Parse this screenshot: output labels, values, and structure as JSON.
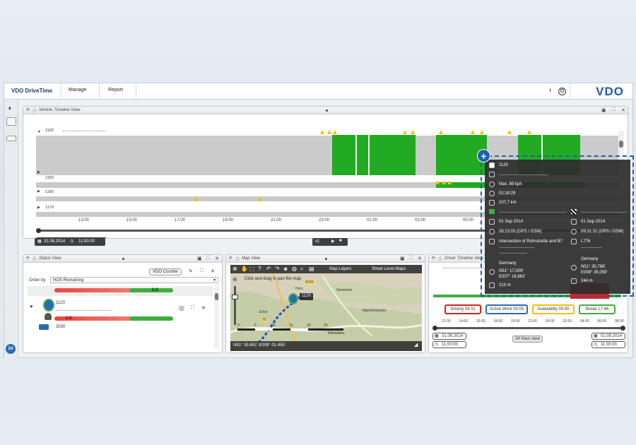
{
  "app": {
    "brand": "VDO DriveTime",
    "nav": [
      "Manage",
      "Report"
    ],
    "logo": "VDO",
    "info_label": "i"
  },
  "vehicle_timeline": {
    "title": "Vehicle Timeline View",
    "vehicles": [
      "1120",
      "1150",
      "1160",
      "1170"
    ],
    "hours": [
      "13:00",
      "15:00",
      "17:00",
      "19:00",
      "21:00",
      "23:00",
      "01:00",
      "03:00",
      "05:00"
    ],
    "date": "31.08.2014",
    "time": "11:00:00",
    "speed": "x1"
  },
  "status": {
    "title": "Status View",
    "counter_button": "VDO Counter",
    "order_by_label": "Order by",
    "order_by_value": "HOS Remaining",
    "row1_value": "8.8",
    "row2_vehicle": "1120",
    "row2_value": "0.9",
    "row3_vehicle": "3030"
  },
  "map": {
    "title": "Map View",
    "layers_label": "Map Layers",
    "maptype_label": "Street Level Maps",
    "hint": "Click and drag to pan the map",
    "marker_label": "1120",
    "scale": [
      "0",
      "5",
      "10",
      "15",
      "20",
      "25"
    ],
    "scale_unit": "Kilometers",
    "coords": "N51° 33.651' E009° 01.455'",
    "places": [
      "Horn",
      "Steinheim",
      "Marienmünster",
      "B1",
      "B239",
      "Schie"
    ]
  },
  "driver": {
    "title": "Driver Timeline View",
    "driving": "Driving 04:31",
    "active_work": "Active Work 00:05",
    "availability": "Availability 00:00",
    "break": "Break 17:46",
    "hours": [
      "12:00",
      "14:00",
      "16:00",
      "18:00",
      "20:00",
      "22:00",
      "00:00",
      "02:00",
      "04:00",
      "06:00",
      "08:00"
    ],
    "start_date": "31.08.2014",
    "start_time": "11:00:00",
    "end_date": "01.09.2014",
    "end_time": "11:00:00",
    "view_button": "24 Hour view"
  },
  "popup": {
    "vehicle": "1120",
    "speed": "Max. 89 kph",
    "duration": "01:18:29",
    "distance": "107,7 km",
    "start_date": "01 Sep 2014",
    "start_time": "08:13:03 (GPS / GSM)",
    "start_place": "Intersection of Ruhrstraße and B7",
    "start_country": "Germany",
    "start_lat": "N51° 17,509'",
    "start_lon": "E007° 16,862'",
    "start_alt": "213 m",
    "end_date": "01 Sep 2014",
    "end_time": "09:31:32 (GPS / GSM)",
    "end_place": "L776",
    "end_country": "Germany",
    "end_lat": "N51° 35,788'",
    "end_lon": "E008° 35,059'",
    "end_alt": "244 m"
  },
  "badge": "24"
}
